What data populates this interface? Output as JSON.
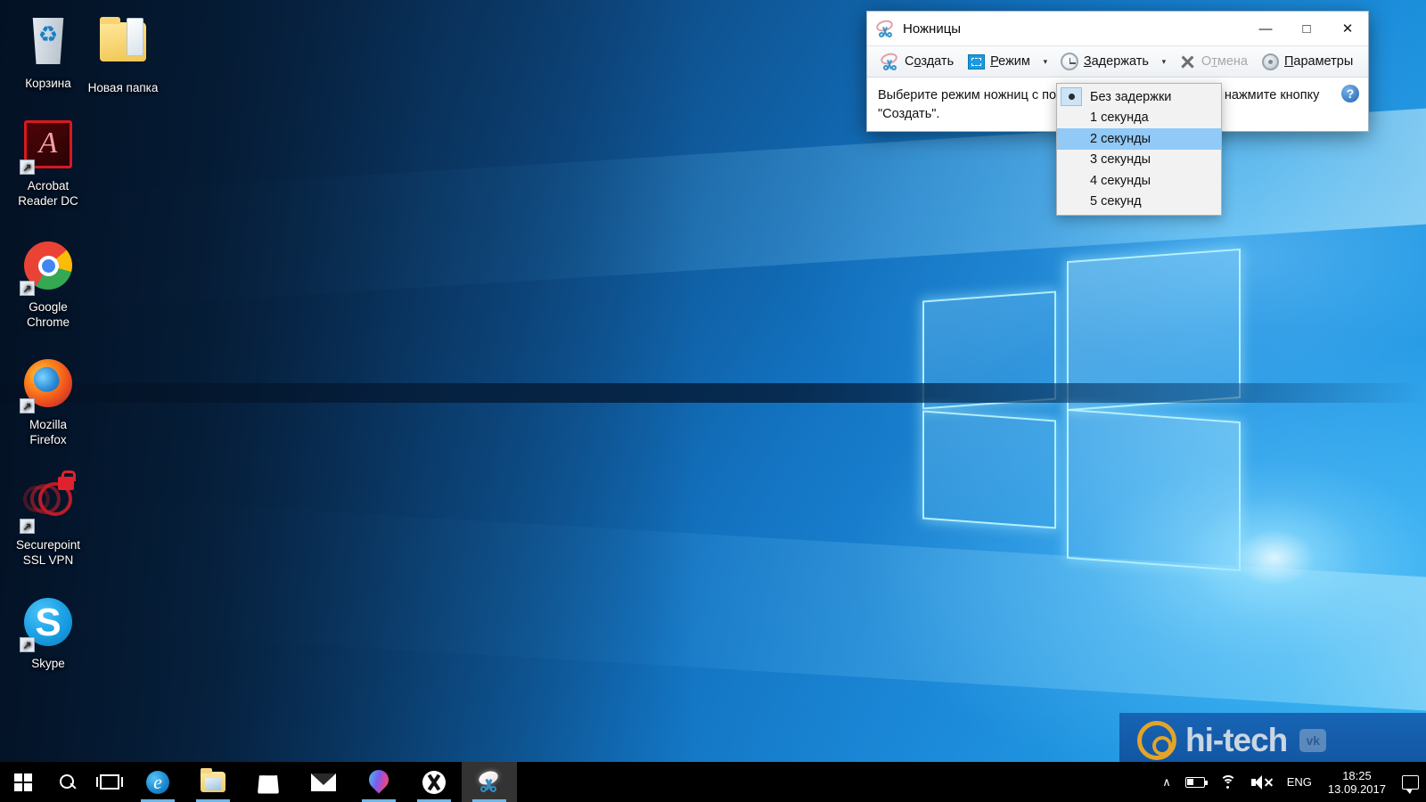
{
  "desktop": {
    "icons": [
      {
        "label": "Корзина",
        "icon": "recycle-bin-icon",
        "shortcut": false
      },
      {
        "label": "Новая папка",
        "icon": "folder-icon",
        "shortcut": false
      },
      {
        "label": "Acrobat\nReader DC",
        "label_line1": "Acrobat",
        "label_line2": "Reader DC",
        "icon": "acrobat-reader-icon",
        "shortcut": true
      },
      {
        "label_line1": "Google",
        "label_line2": "Chrome",
        "icon": "google-chrome-icon",
        "shortcut": true
      },
      {
        "label_line1": "Mozilla",
        "label_line2": "Firefox",
        "icon": "mozilla-firefox-icon",
        "shortcut": true
      },
      {
        "label_line1": "Securepoint",
        "label_line2": "SSL VPN",
        "icon": "securepoint-vpn-icon",
        "shortcut": true
      },
      {
        "label_line1": "Skype",
        "label_line2": "",
        "icon": "skype-icon",
        "shortcut": true
      }
    ]
  },
  "snipping_tool": {
    "title": "Ножницы",
    "title_icon": "scissors-icon",
    "window_controls": {
      "minimize": "—",
      "maximize": "□",
      "close": "✕"
    },
    "toolbar": {
      "new": {
        "label": "Создать",
        "accel_index": 1,
        "icon": "scissors-icon"
      },
      "mode": {
        "label": "Режим",
        "accel_index": 0,
        "icon": "mode-rectangle-icon",
        "caret": "▾"
      },
      "delay": {
        "label": "Задержать",
        "accel_index": 0,
        "icon": "clock-icon",
        "caret": "▾"
      },
      "cancel": {
        "label": "Отмена",
        "accel_index": 1,
        "icon": "cancel-x-icon",
        "disabled": true
      },
      "options": {
        "label": "Параметры",
        "accel_index": 0,
        "icon": "gear-icon"
      }
    },
    "instruction": "Выберите режим ножниц с помощью кнопки \"Режим\" или нажмите кнопку \"Создать\".",
    "help": {
      "label": "?",
      "icon": "help-icon"
    }
  },
  "delay_menu": {
    "items": [
      {
        "label": "Без задержки",
        "checked": true,
        "selected": false
      },
      {
        "label": "1 секунда",
        "checked": false,
        "selected": false
      },
      {
        "label": "2 секунды",
        "checked": false,
        "selected": true
      },
      {
        "label": "3 секунды",
        "checked": false,
        "selected": false
      },
      {
        "label": "4 секунды",
        "checked": false,
        "selected": false
      },
      {
        "label": "5 секунд",
        "checked": false,
        "selected": false
      }
    ],
    "highlight_color": "#91c9f7"
  },
  "taskbar": {
    "start": {
      "icon": "windows-start-icon"
    },
    "search": {
      "icon": "search-icon"
    },
    "task_view": {
      "icon": "task-view-icon"
    },
    "apps": [
      {
        "name": "microsoft-edge",
        "icon": "edge-icon",
        "glyph": "e",
        "running": true,
        "active": false
      },
      {
        "name": "file-explorer",
        "icon": "file-explorer-icon",
        "running": true,
        "active": false
      },
      {
        "name": "microsoft-store",
        "icon": "store-icon",
        "running": false,
        "active": false
      },
      {
        "name": "mail",
        "icon": "mail-icon",
        "running": false,
        "active": false
      },
      {
        "name": "maps",
        "icon": "maps-icon",
        "running": true,
        "active": false
      },
      {
        "name": "xbox",
        "icon": "xbox-icon",
        "running": true,
        "active": false
      },
      {
        "name": "snipping-tool",
        "icon": "scissors-icon",
        "running": true,
        "active": true
      }
    ],
    "tray": {
      "chevron": {
        "icon": "chevron-up-icon",
        "glyph": "∧"
      },
      "battery": {
        "icon": "battery-icon"
      },
      "network": {
        "icon": "wifi-icon"
      },
      "volume": {
        "icon": "volume-muted-icon"
      },
      "language": "ENG",
      "clock": {
        "time": "18:25",
        "date": "13.09.2017"
      },
      "action_center": {
        "icon": "action-center-icon"
      }
    }
  },
  "watermark": {
    "at_symbol": "@",
    "text": "hi-tech",
    "vk_badge": "vk"
  }
}
